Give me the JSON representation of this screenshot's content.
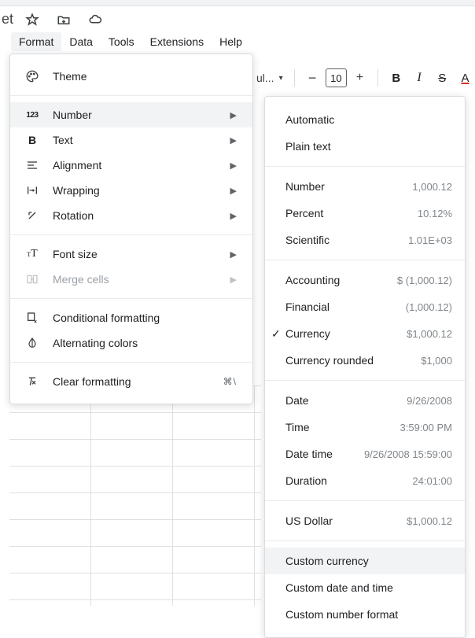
{
  "title_bar": {
    "truncated_title": "et"
  },
  "menubar": {
    "format": "Format",
    "data": "Data",
    "tools": "Tools",
    "extensions": "Extensions",
    "help": "Help"
  },
  "toolbar": {
    "font_dropdown_text": "ul...",
    "font_size": "10",
    "bold": "B",
    "italic": "I",
    "strikethrough": "S",
    "text_color": "A"
  },
  "format_menu": {
    "theme": "Theme",
    "number": "Number",
    "text": "Text",
    "alignment": "Alignment",
    "wrapping": "Wrapping",
    "rotation": "Rotation",
    "font_size": "Font size",
    "merge_cells": "Merge cells",
    "conditional_formatting": "Conditional formatting",
    "alternating_colors": "Alternating colors",
    "clear_formatting": "Clear formatting",
    "clear_formatting_shortcut": "⌘\\"
  },
  "number_submenu": {
    "automatic": "Automatic",
    "plain_text": "Plain text",
    "number": {
      "label": "Number",
      "example": "1,000.12"
    },
    "percent": {
      "label": "Percent",
      "example": "10.12%"
    },
    "scientific": {
      "label": "Scientific",
      "example": "1.01E+03"
    },
    "accounting": {
      "label": "Accounting",
      "example": "$ (1,000.12)"
    },
    "financial": {
      "label": "Financial",
      "example": "(1,000.12)"
    },
    "currency": {
      "label": "Currency",
      "example": "$1,000.12"
    },
    "currency_rounded": {
      "label": "Currency rounded",
      "example": "$1,000"
    },
    "date": {
      "label": "Date",
      "example": "9/26/2008"
    },
    "time": {
      "label": "Time",
      "example": "3:59:00 PM"
    },
    "date_time": {
      "label": "Date time",
      "example": "9/26/2008 15:59:00"
    },
    "duration": {
      "label": "Duration",
      "example": "24:01:00"
    },
    "us_dollar": {
      "label": "US Dollar",
      "example": "$1,000.12"
    },
    "custom_currency": "Custom currency",
    "custom_date_time": "Custom date and time",
    "custom_number_format": "Custom number format"
  }
}
